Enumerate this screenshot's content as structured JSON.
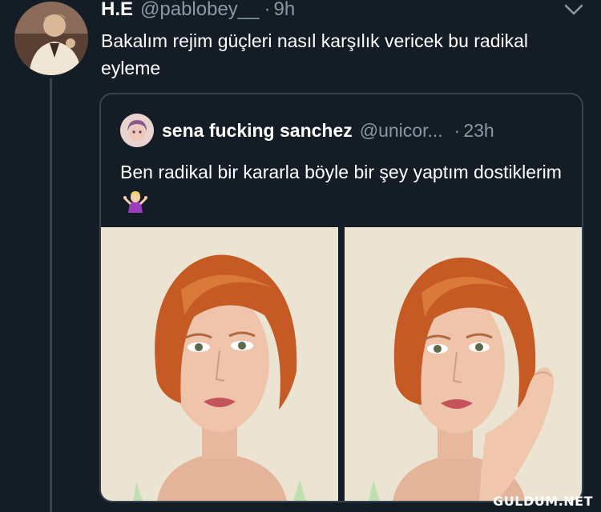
{
  "tweet": {
    "author_name": "H.E",
    "author_handle": "@pablobey__",
    "separator": "·",
    "timestamp": "9h",
    "text": "Bakalım rejim güçleri nasıl karşılık vericek bu radikal eyleme",
    "avatar_icon": "avatar-man-in-suit"
  },
  "quoted_tweet": {
    "author_name": "sena fucking sanchez",
    "author_handle": "@unicor...",
    "separator": "·",
    "timestamp": "23h",
    "text": "Ben radikal bir kararla böyle bir şey yaptım dostiklerim",
    "emoji_icon": "person-shrugging-emoji",
    "photos": [
      {
        "description_icon": "photo-woman-red-bob-hair"
      },
      {
        "description_icon": "photo-woman-red-bob-hair-hand-on-cheek"
      }
    ]
  },
  "menu_icon": "chevron-down-icon",
  "watermark": "GULDUM.NET",
  "colors": {
    "background": "#141d26",
    "text_primary": "#ffffff",
    "text_secondary": "#8899a6",
    "border": "#38444d"
  }
}
